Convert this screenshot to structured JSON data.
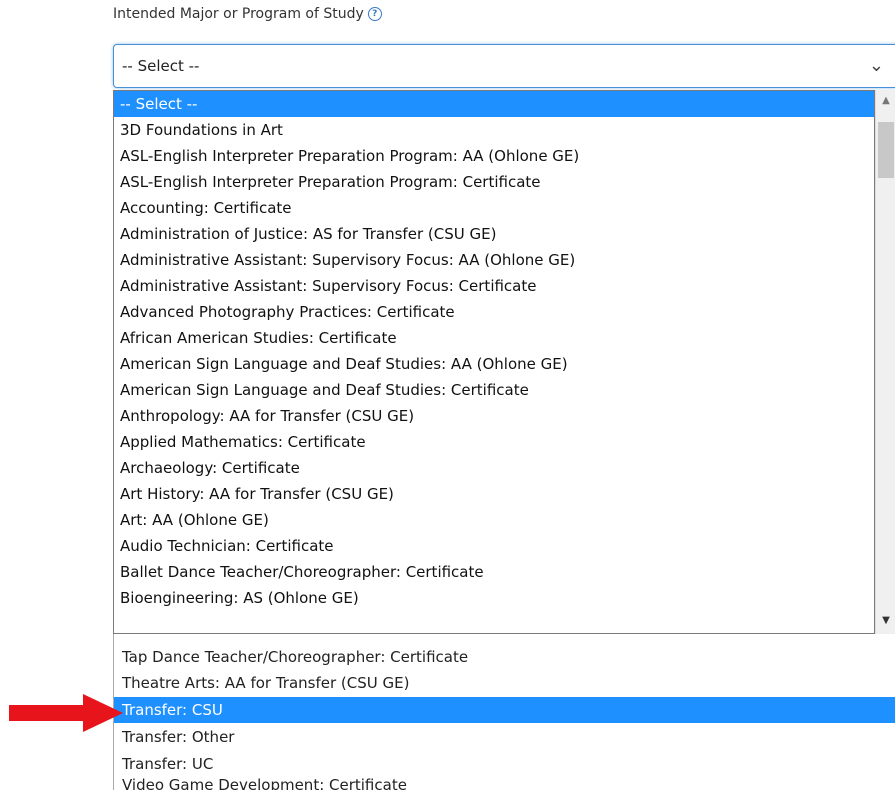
{
  "field": {
    "label": "Intended Major or Program of Study",
    "help_icon": "question-circle-icon",
    "value": "-- Select --",
    "chevron_icon": "chevron-down-icon"
  },
  "dropdown_options": [
    "-- Select --",
    "3D Foundations in Art",
    "ASL-English Interpreter Preparation Program: AA (Ohlone GE)",
    "ASL-English Interpreter Preparation Program: Certificate",
    "Accounting: Certificate",
    "Administration of Justice: AS for Transfer (CSU GE)",
    "Administrative Assistant: Supervisory Focus: AA (Ohlone GE)",
    "Administrative Assistant: Supervisory Focus: Certificate",
    "Advanced Photography Practices: Certificate",
    "African American Studies: Certificate",
    "American Sign Language and Deaf Studies: AA (Ohlone GE)",
    "American Sign Language and Deaf Studies: Certificate",
    "Anthropology: AA for Transfer (CSU GE)",
    "Applied Mathematics: Certificate",
    "Archaeology: Certificate",
    "Art History: AA for Transfer (CSU GE)",
    "Art: AA (Ohlone GE)",
    "Audio Technician: Certificate",
    "Ballet Dance Teacher/Choreographer: Certificate",
    "Bioengineering: AS (Ohlone GE)"
  ],
  "background_list": [
    "Tap Dance Teacher/Choreographer: Certificate",
    "Theatre Arts: AA for Transfer (CSU GE)",
    "Transfer: CSU",
    "Transfer: Other",
    "Transfer: UC",
    "Video Game Development: Certificate"
  ],
  "colors": {
    "selection": "#1e90ff",
    "arrow": "#e8141b",
    "focus_border": "#4a90d9"
  }
}
